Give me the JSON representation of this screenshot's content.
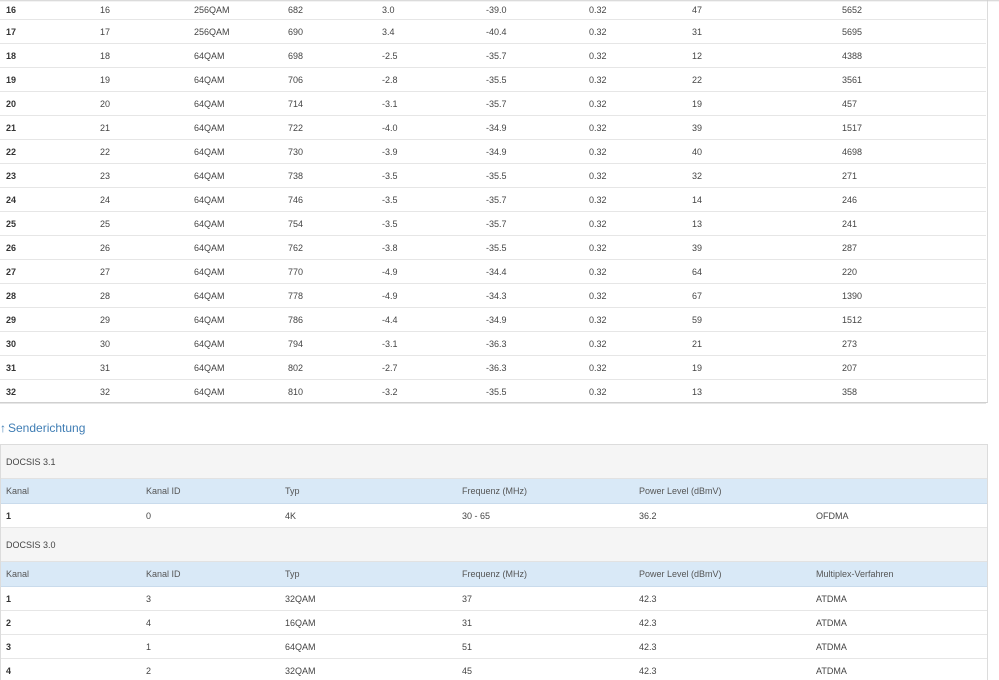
{
  "downstream": {
    "rows": [
      [
        "16",
        "16",
        "256QAM",
        "682",
        "3.0",
        "-39.0",
        "0.32",
        "47",
        "5652"
      ],
      [
        "17",
        "17",
        "256QAM",
        "690",
        "3.4",
        "-40.4",
        "0.32",
        "31",
        "5695"
      ],
      [
        "18",
        "18",
        "64QAM",
        "698",
        "-2.5",
        "-35.7",
        "0.32",
        "12",
        "4388"
      ],
      [
        "19",
        "19",
        "64QAM",
        "706",
        "-2.8",
        "-35.5",
        "0.32",
        "22",
        "3561"
      ],
      [
        "20",
        "20",
        "64QAM",
        "714",
        "-3.1",
        "-35.7",
        "0.32",
        "19",
        "457"
      ],
      [
        "21",
        "21",
        "64QAM",
        "722",
        "-4.0",
        "-34.9",
        "0.32",
        "39",
        "1517"
      ],
      [
        "22",
        "22",
        "64QAM",
        "730",
        "-3.9",
        "-34.9",
        "0.32",
        "40",
        "4698"
      ],
      [
        "23",
        "23",
        "64QAM",
        "738",
        "-3.5",
        "-35.5",
        "0.32",
        "32",
        "271"
      ],
      [
        "24",
        "24",
        "64QAM",
        "746",
        "-3.5",
        "-35.7",
        "0.32",
        "14",
        "246"
      ],
      [
        "25",
        "25",
        "64QAM",
        "754",
        "-3.5",
        "-35.7",
        "0.32",
        "13",
        "241"
      ],
      [
        "26",
        "26",
        "64QAM",
        "762",
        "-3.8",
        "-35.5",
        "0.32",
        "39",
        "287"
      ],
      [
        "27",
        "27",
        "64QAM",
        "770",
        "-4.9",
        "-34.4",
        "0.32",
        "64",
        "220"
      ],
      [
        "28",
        "28",
        "64QAM",
        "778",
        "-4.9",
        "-34.3",
        "0.32",
        "67",
        "1390"
      ],
      [
        "29",
        "29",
        "64QAM",
        "786",
        "-4.4",
        "-34.9",
        "0.32",
        "59",
        "1512"
      ],
      [
        "30",
        "30",
        "64QAM",
        "794",
        "-3.1",
        "-36.3",
        "0.32",
        "21",
        "273"
      ],
      [
        "31",
        "31",
        "64QAM",
        "802",
        "-2.7",
        "-36.3",
        "0.32",
        "19",
        "207"
      ],
      [
        "32",
        "32",
        "64QAM",
        "810",
        "-3.2",
        "-35.5",
        "0.32",
        "13",
        "358"
      ]
    ]
  },
  "upstream": {
    "arrow": "↑",
    "title": "Senderichtung",
    "docsis31": {
      "title": "DOCSIS 3.1",
      "headers": [
        "Kanal",
        "Kanal ID",
        "Typ",
        "Frequenz (MHz)",
        "Power Level (dBmV)",
        ""
      ],
      "rows": [
        [
          "1",
          "0",
          "4K",
          "30 - 65",
          "36.2",
          "OFDMA"
        ]
      ]
    },
    "docsis30": {
      "title": "DOCSIS 3.0",
      "headers": [
        "Kanal",
        "Kanal ID",
        "Typ",
        "Frequenz (MHz)",
        "Power Level (dBmV)",
        "Multiplex-Verfahren"
      ],
      "rows": [
        [
          "1",
          "3",
          "32QAM",
          "37",
          "42.3",
          "ATDMA"
        ],
        [
          "2",
          "4",
          "16QAM",
          "31",
          "42.3",
          "ATDMA"
        ],
        [
          "3",
          "1",
          "64QAM",
          "51",
          "42.3",
          "ATDMA"
        ],
        [
          "4",
          "2",
          "32QAM",
          "45",
          "42.3",
          "ATDMA"
        ]
      ]
    }
  }
}
